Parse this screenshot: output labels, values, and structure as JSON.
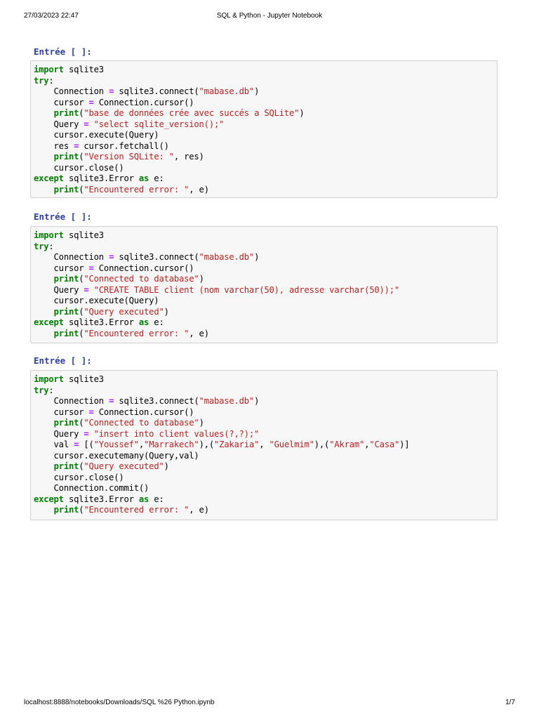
{
  "header": {
    "datetime": "27/03/2023 22:47",
    "title": "SQL & Python - Jupyter Notebook"
  },
  "footer": {
    "url": "localhost:8888/notebooks/Downloads/SQL %26 Python.ipynb",
    "page": "1/7"
  },
  "colors": {
    "keyword": "#008000",
    "string": "#ba2121",
    "operator": "#aa22ff",
    "prompt": "#303f9f"
  },
  "cells": [
    {
      "prompt": "Entrée [ ]:",
      "lines": [
        [
          [
            "k",
            "import"
          ],
          [
            "n",
            " sqlite3"
          ]
        ],
        [
          [
            "k",
            "try"
          ],
          [
            "n",
            ":"
          ]
        ],
        [
          [
            "n",
            "    Connection "
          ],
          [
            "o",
            "="
          ],
          [
            "n",
            " sqlite3.connect("
          ],
          [
            "s",
            "\"mabase.db\""
          ],
          [
            "n",
            ")"
          ]
        ],
        [
          [
            "n",
            "    cursor "
          ],
          [
            "o",
            "="
          ],
          [
            "n",
            " Connection.cursor()"
          ]
        ],
        [
          [
            "n",
            "    "
          ],
          [
            "k",
            "print"
          ],
          [
            "n",
            "("
          ],
          [
            "s",
            "\"base de données crée avec succés a SQLite\""
          ],
          [
            "n",
            ")"
          ]
        ],
        [
          [
            "n",
            "    Query "
          ],
          [
            "o",
            "="
          ],
          [
            "n",
            " "
          ],
          [
            "s",
            "\"select sqlite_version();\""
          ]
        ],
        [
          [
            "n",
            "    cursor.execute(Query)"
          ]
        ],
        [
          [
            "n",
            "    res "
          ],
          [
            "o",
            "="
          ],
          [
            "n",
            " cursor.fetchall()"
          ]
        ],
        [
          [
            "n",
            "    "
          ],
          [
            "k",
            "print"
          ],
          [
            "n",
            "("
          ],
          [
            "s",
            "\"Version SQLite: \""
          ],
          [
            "n",
            ", res)"
          ]
        ],
        [
          [
            "n",
            "    cursor.close()"
          ]
        ],
        [
          [
            "k",
            "except"
          ],
          [
            "n",
            " sqlite3.Error "
          ],
          [
            "k",
            "as"
          ],
          [
            "n",
            " e:"
          ]
        ],
        [
          [
            "n",
            "    "
          ],
          [
            "k",
            "print"
          ],
          [
            "n",
            "("
          ],
          [
            "s",
            "\"Encountered error: \""
          ],
          [
            "n",
            ", e)"
          ]
        ]
      ]
    },
    {
      "prompt": "Entrée [ ]:",
      "lines": [
        [
          [
            "k",
            "import"
          ],
          [
            "n",
            " sqlite3"
          ]
        ],
        [
          [
            "k",
            "try"
          ],
          [
            "n",
            ":"
          ]
        ],
        [
          [
            "n",
            "    Connection "
          ],
          [
            "o",
            "="
          ],
          [
            "n",
            " sqlite3.connect("
          ],
          [
            "s",
            "\"mabase.db\""
          ],
          [
            "n",
            ")"
          ]
        ],
        [
          [
            "n",
            "    cursor "
          ],
          [
            "o",
            "="
          ],
          [
            "n",
            " Connection.cursor()"
          ]
        ],
        [
          [
            "n",
            "    "
          ],
          [
            "k",
            "print"
          ],
          [
            "n",
            "("
          ],
          [
            "s",
            "\"Connected to database\""
          ],
          [
            "n",
            ")"
          ]
        ],
        [
          [
            "n",
            "    Query "
          ],
          [
            "o",
            "="
          ],
          [
            "n",
            " "
          ],
          [
            "s",
            "\"CREATE TABLE client (nom varchar(50), adresse varchar(50));\""
          ]
        ],
        [
          [
            "n",
            "    cursor.execute(Query)"
          ]
        ],
        [
          [
            "n",
            "    "
          ],
          [
            "k",
            "print"
          ],
          [
            "n",
            "("
          ],
          [
            "s",
            "\"Query executed\""
          ],
          [
            "n",
            ")"
          ]
        ],
        [
          [
            "k",
            "except"
          ],
          [
            "n",
            " sqlite3.Error "
          ],
          [
            "k",
            "as"
          ],
          [
            "n",
            " e:"
          ]
        ],
        [
          [
            "n",
            "    "
          ],
          [
            "k",
            "print"
          ],
          [
            "n",
            "("
          ],
          [
            "s",
            "\"Encountered error: \""
          ],
          [
            "n",
            ", e)"
          ]
        ]
      ]
    },
    {
      "prompt": "Entrée [ ]:",
      "lines": [
        [
          [
            "k",
            "import"
          ],
          [
            "n",
            " sqlite3"
          ]
        ],
        [
          [
            "k",
            "try"
          ],
          [
            "n",
            ":"
          ]
        ],
        [
          [
            "n",
            "    Connection "
          ],
          [
            "o",
            "="
          ],
          [
            "n",
            " sqlite3.connect("
          ],
          [
            "s",
            "\"mabase.db\""
          ],
          [
            "n",
            ")"
          ]
        ],
        [
          [
            "n",
            "    cursor "
          ],
          [
            "o",
            "="
          ],
          [
            "n",
            " Connection.cursor()"
          ]
        ],
        [
          [
            "n",
            "    "
          ],
          [
            "k",
            "print"
          ],
          [
            "n",
            "("
          ],
          [
            "s",
            "\"Connected to database\""
          ],
          [
            "n",
            ")"
          ]
        ],
        [
          [
            "n",
            "    Query "
          ],
          [
            "o",
            "="
          ],
          [
            "n",
            " "
          ],
          [
            "s",
            "\"insert into client values(?,?);\""
          ]
        ],
        [
          [
            "n",
            "    val "
          ],
          [
            "o",
            "="
          ],
          [
            "n",
            " [("
          ],
          [
            "s",
            "\"Youssef\""
          ],
          [
            "n",
            ","
          ],
          [
            "s",
            "\"Marrakech\""
          ],
          [
            "n",
            "),("
          ],
          [
            "s",
            "\"Zakaria\""
          ],
          [
            "n",
            ", "
          ],
          [
            "s",
            "\"Guelmim\""
          ],
          [
            "n",
            "),("
          ],
          [
            "s",
            "\"Akram\""
          ],
          [
            "n",
            ","
          ],
          [
            "s",
            "\"Casa\""
          ],
          [
            "n",
            ")]"
          ]
        ],
        [
          [
            "n",
            "    cursor.executemany(Query,val)"
          ]
        ],
        [
          [
            "n",
            "    "
          ],
          [
            "k",
            "print"
          ],
          [
            "n",
            "("
          ],
          [
            "s",
            "\"Query executed\""
          ],
          [
            "n",
            ")"
          ]
        ],
        [
          [
            "n",
            "    cursor.close()"
          ]
        ],
        [
          [
            "n",
            "    Connection.commit()"
          ]
        ],
        [
          [
            "k",
            "except"
          ],
          [
            "n",
            " sqlite3.Error "
          ],
          [
            "k",
            "as"
          ],
          [
            "n",
            " e:"
          ]
        ],
        [
          [
            "n",
            "    "
          ],
          [
            "k",
            "print"
          ],
          [
            "n",
            "("
          ],
          [
            "s",
            "\"Encountered error: \""
          ],
          [
            "n",
            ", e)"
          ]
        ]
      ]
    }
  ]
}
